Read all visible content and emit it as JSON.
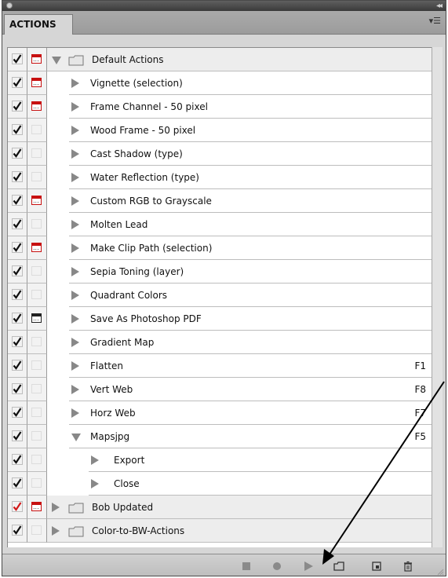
{
  "panel": {
    "tab_label": "ACTIONS",
    "colors": {
      "accent_red": "#c71010",
      "check": "#111111",
      "check_red": "#d11a1a",
      "triangle": "#888888"
    }
  },
  "rows": [
    {
      "kind": "set",
      "label": "Default Actions",
      "checked": true,
      "check_color": "black",
      "dialog": "red",
      "expanded": true,
      "shortcut": ""
    },
    {
      "kind": "action",
      "label": "Vignette (selection)",
      "checked": true,
      "dialog": "red",
      "expanded": false,
      "shortcut": ""
    },
    {
      "kind": "action",
      "label": "Frame Channel - 50 pixel",
      "checked": true,
      "dialog": "red",
      "expanded": false,
      "shortcut": ""
    },
    {
      "kind": "action",
      "label": "Wood Frame - 50 pixel",
      "checked": true,
      "dialog": "none",
      "expanded": false,
      "shortcut": ""
    },
    {
      "kind": "action",
      "label": "Cast Shadow (type)",
      "checked": true,
      "dialog": "none",
      "expanded": false,
      "shortcut": ""
    },
    {
      "kind": "action",
      "label": "Water Reflection (type)",
      "checked": true,
      "dialog": "none",
      "expanded": false,
      "shortcut": ""
    },
    {
      "kind": "action",
      "label": "Custom RGB to Grayscale",
      "checked": true,
      "dialog": "red",
      "expanded": false,
      "shortcut": ""
    },
    {
      "kind": "action",
      "label": "Molten Lead",
      "checked": true,
      "dialog": "none",
      "expanded": false,
      "shortcut": ""
    },
    {
      "kind": "action",
      "label": "Make Clip Path (selection)",
      "checked": true,
      "dialog": "red",
      "expanded": false,
      "shortcut": ""
    },
    {
      "kind": "action",
      "label": "Sepia Toning (layer)",
      "checked": true,
      "dialog": "none",
      "expanded": false,
      "shortcut": ""
    },
    {
      "kind": "action",
      "label": "Quadrant Colors",
      "checked": true,
      "dialog": "none",
      "expanded": false,
      "shortcut": ""
    },
    {
      "kind": "action",
      "label": "Save As Photoshop PDF",
      "checked": true,
      "dialog": "black",
      "expanded": false,
      "shortcut": ""
    },
    {
      "kind": "action",
      "label": "Gradient Map",
      "checked": true,
      "dialog": "none",
      "expanded": false,
      "shortcut": ""
    },
    {
      "kind": "action",
      "label": "Flatten",
      "checked": true,
      "dialog": "none",
      "expanded": false,
      "shortcut": "F1"
    },
    {
      "kind": "action",
      "label": "Vert Web",
      "checked": true,
      "dialog": "none",
      "expanded": false,
      "shortcut": "F8"
    },
    {
      "kind": "action",
      "label": "Horz Web",
      "checked": true,
      "dialog": "none",
      "expanded": false,
      "shortcut": "F7"
    },
    {
      "kind": "action",
      "label": "Mapsjpg",
      "checked": true,
      "dialog": "none",
      "expanded": true,
      "shortcut": "F5"
    },
    {
      "kind": "step",
      "label": "Export",
      "checked": true,
      "dialog": "none",
      "expanded": false,
      "shortcut": ""
    },
    {
      "kind": "step",
      "label": "Close",
      "checked": true,
      "dialog": "none",
      "expanded": false,
      "shortcut": ""
    },
    {
      "kind": "set",
      "label": "Bob Updated",
      "checked": true,
      "check_color": "red",
      "dialog": "red",
      "expanded": false,
      "shortcut": ""
    },
    {
      "kind": "set",
      "label": "Color-to-BW-Actions",
      "checked": true,
      "check_color": "black",
      "dialog": "none",
      "expanded": false,
      "shortcut": ""
    }
  ],
  "toolbar": {
    "icons": [
      "stop-icon",
      "record-icon",
      "play-icon",
      "new-set-icon",
      "new-action-icon",
      "trash-icon"
    ]
  }
}
